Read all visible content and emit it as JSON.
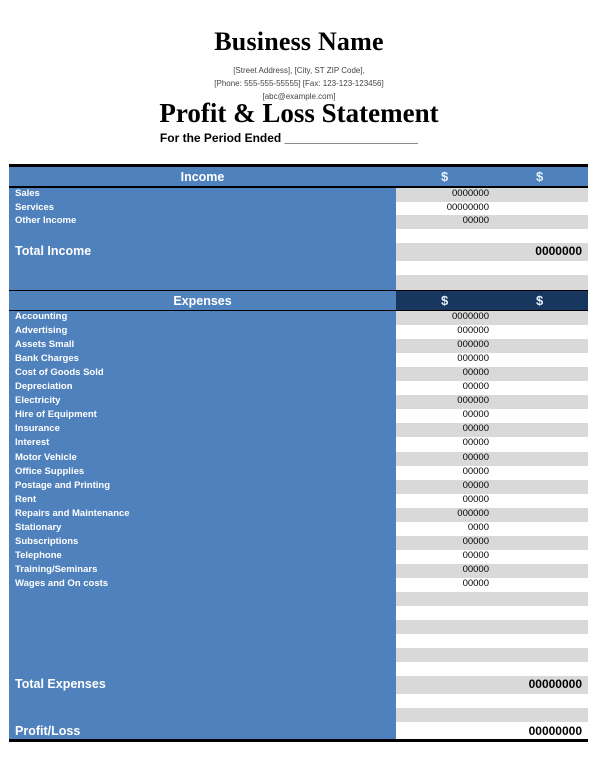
{
  "header": {
    "business_name": "Business Name",
    "address_line": "[Street  Address], [City, ST ZIP Code],",
    "phone_fax_line": "[Phone: 555-555-55555] [Fax: 123-123-123456]",
    "email_line": "[abc@example.com]",
    "title": "Profit & Loss Statement",
    "period_label": "For the Period Ended ____________________"
  },
  "colors": {
    "label_column": "#4f81bd",
    "expenses_value_header": "#17375e",
    "stripe_gray": "#d9d9d9",
    "stripe_white": "#ffffff"
  },
  "income": {
    "heading": "Income",
    "currency_headers": [
      "$",
      "$"
    ],
    "items": [
      {
        "label": "Sales",
        "value": "0000000"
      },
      {
        "label": "Services",
        "value": "00000000"
      },
      {
        "label": "Other Income",
        "value": "00000"
      }
    ],
    "total_label": "Total Income",
    "total_value": "0000000"
  },
  "expenses": {
    "heading": "Expenses",
    "currency_headers": [
      "$",
      "$"
    ],
    "items": [
      {
        "label": "Accounting",
        "value": "0000000"
      },
      {
        "label": "Advertising",
        "value": "000000"
      },
      {
        "label": "Assets Small",
        "value": "000000"
      },
      {
        "label": "Bank Charges",
        "value": "000000"
      },
      {
        "label": "Cost of Goods Sold",
        "value": "00000"
      },
      {
        "label": "Depreciation",
        "value": "00000"
      },
      {
        "label": "Electricity",
        "value": "000000"
      },
      {
        "label": "Hire of Equipment",
        "value": "00000"
      },
      {
        "label": "Insurance",
        "value": "00000"
      },
      {
        "label": "Interest",
        "value": "00000"
      },
      {
        "label": "Motor Vehicle",
        "value": "00000"
      },
      {
        "label": "Office Supplies",
        "value": "00000"
      },
      {
        "label": "Postage  and Printing",
        "value": "00000"
      },
      {
        "label": "Rent",
        "value": "00000"
      },
      {
        "label": "Repairs and Maintenance",
        "value": "000000"
      },
      {
        "label": "Stationary",
        "value": "0000"
      },
      {
        "label": "Subscriptions",
        "value": "00000"
      },
      {
        "label": "Telephone",
        "value": "00000"
      },
      {
        "label": "Training/Seminars",
        "value": "00000"
      },
      {
        "label": "Wages and On costs",
        "value": "00000"
      }
    ],
    "total_label": "Total Expenses",
    "total_value": "00000000"
  },
  "profit_loss": {
    "label": "Profit/Loss",
    "value": "00000000"
  }
}
